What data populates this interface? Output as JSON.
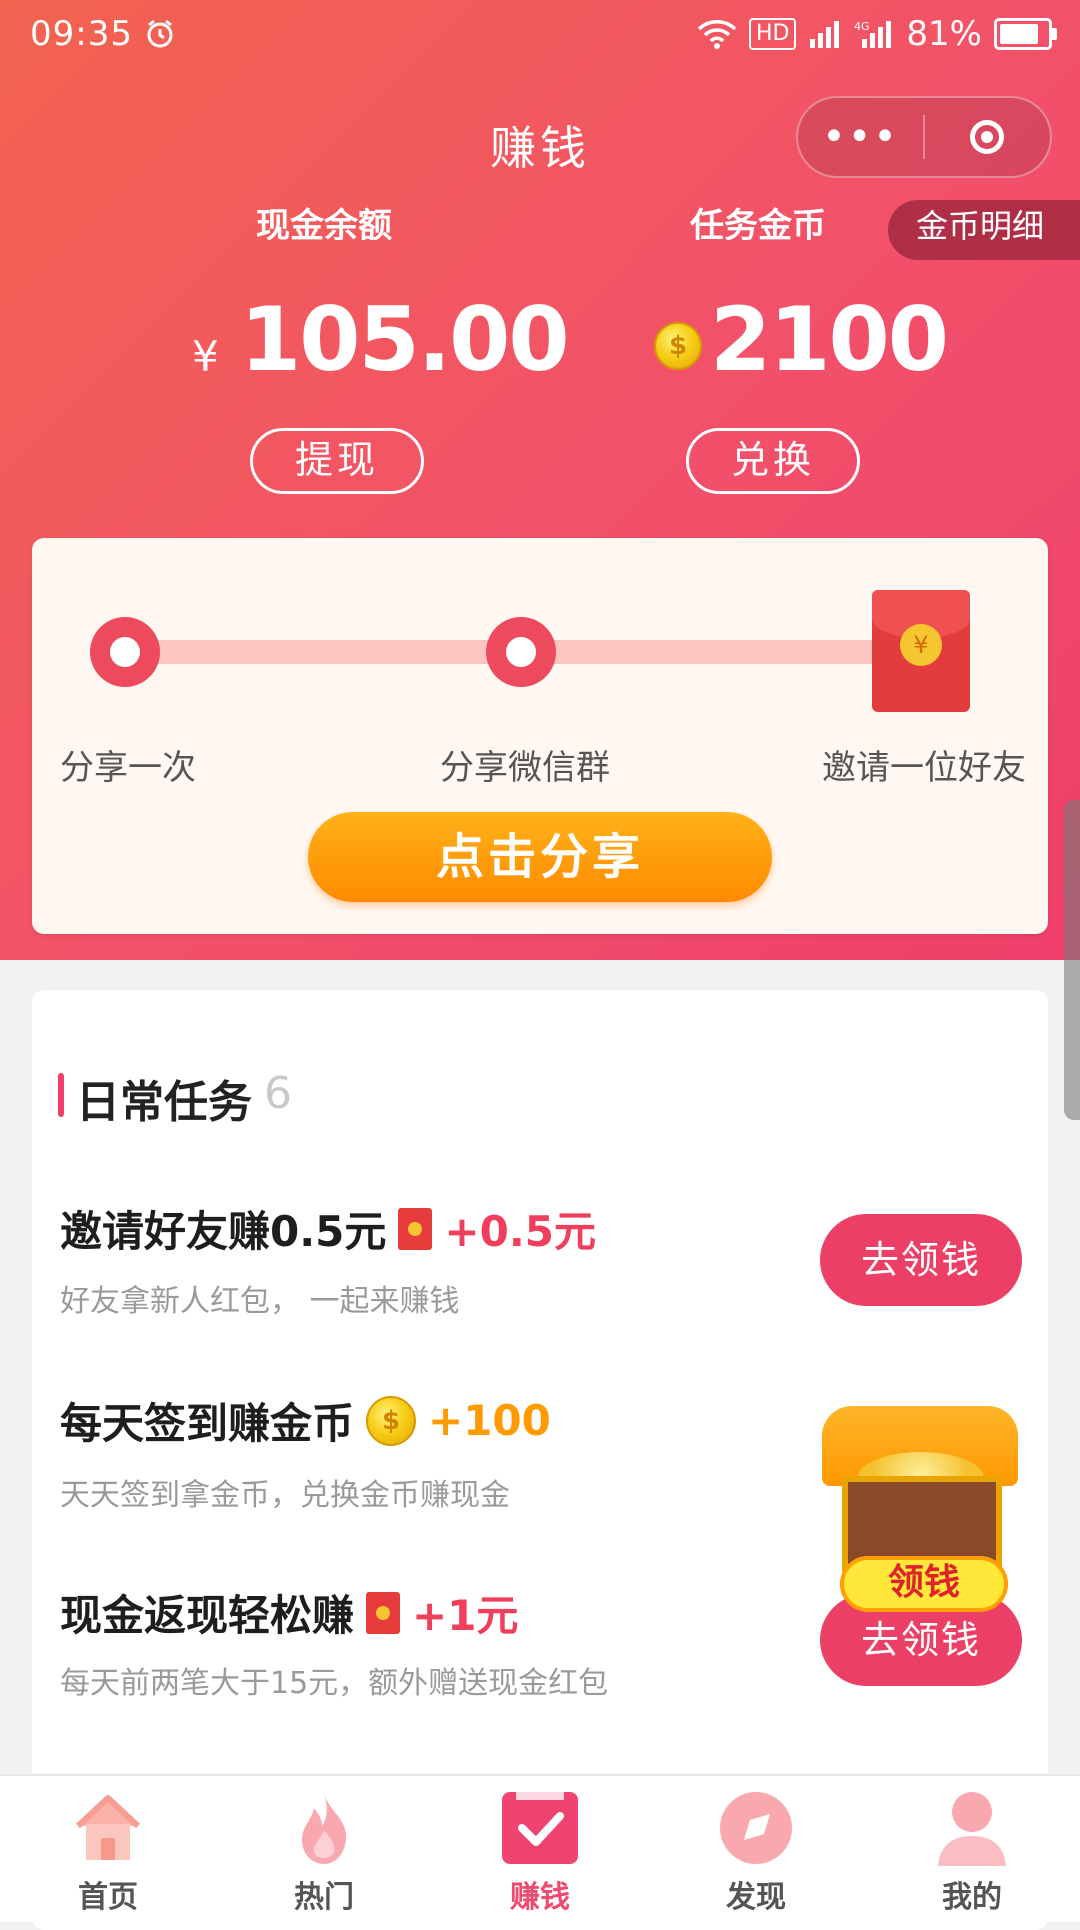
{
  "status_bar": {
    "time": "09:35",
    "alarm_icon": "alarm-icon",
    "hd": "HD",
    "battery": "81%"
  },
  "nav": {
    "title": "赚钱",
    "more": "•••"
  },
  "balance": {
    "cash_label": "现金余额",
    "coin_label": "任务金币",
    "detail_tab": "金币明细",
    "currency_symbol": "¥",
    "cash_amount": "105.00",
    "coin_amount": "2100",
    "coin_symbol": "$",
    "withdraw_label": "提现",
    "exchange_label": "兑换"
  },
  "share_progress": {
    "steps": [
      "分享一次",
      "分享微信群",
      "邀请一位好友"
    ],
    "envelope_symbol": "¥",
    "button_label": "点击分享"
  },
  "tasks": {
    "title": "日常任务",
    "count": "6",
    "items": [
      {
        "title": "邀请好友赚0.5元",
        "reward": "+0.5元",
        "reward_icon": "red-envelope-icon",
        "desc": "好友拿新人红包， 一起来赚钱",
        "action": "去领钱"
      },
      {
        "title": "每天签到赚金币",
        "reward": "+100",
        "reward_icon": "coin-icon",
        "desc": "天天签到拿金币，兑换金币赚现金",
        "action": ""
      },
      {
        "title": "现金返现轻松赚",
        "reward": "+1元",
        "reward_icon": "red-envelope-icon",
        "desc": "每天前两笔大于15元，额外赠送现金红包",
        "action": "去领钱"
      }
    ]
  },
  "chest_popup": {
    "label": "领钱"
  },
  "tabbar": {
    "items": [
      {
        "label": "首页",
        "icon": "home-icon"
      },
      {
        "label": "热门",
        "icon": "flame-icon"
      },
      {
        "label": "赚钱",
        "icon": "checklist-icon",
        "active": true
      },
      {
        "label": "发现",
        "icon": "compass-icon"
      },
      {
        "label": "我的",
        "icon": "user-icon"
      }
    ]
  },
  "colors": {
    "accent": "#ec3f66",
    "orange": "#ff9a00",
    "gradient_start": "#f2634f",
    "gradient_end": "#ee3f6a"
  }
}
